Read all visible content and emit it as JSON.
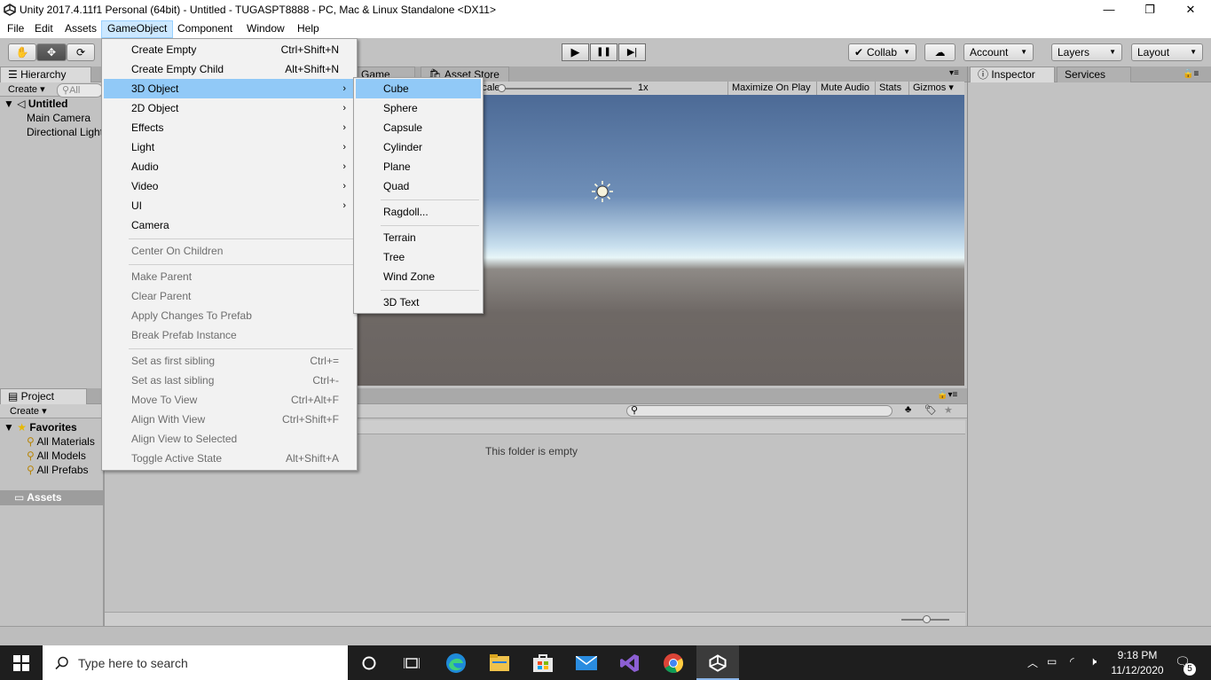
{
  "window": {
    "title": "Unity 2017.4.11f1 Personal (64bit) - Untitled - TUGASPT8888 - PC, Mac & Linux Standalone <DX11>",
    "minimize": "—",
    "restore": "❐",
    "close": "✕"
  },
  "menubar": {
    "items": [
      "File",
      "Edit",
      "Assets",
      "GameObject",
      "Component",
      "Window",
      "Help"
    ],
    "active": "GameObject"
  },
  "toolbar": {
    "tools": [
      "hand-tool",
      "move-tool",
      "rotate-tool"
    ],
    "play": "▶",
    "pause": "❚❚",
    "step": "▶|",
    "collab": "Collab",
    "account": "Account",
    "layers": "Layers",
    "layout": "Layout"
  },
  "hierarchy": {
    "tab": "Hierarchy",
    "create": "Create",
    "search_placeholder": "All",
    "scene": "Untitled",
    "items": [
      "Main Camera",
      "Directional Light"
    ]
  },
  "center_tabs": {
    "game": "Game",
    "asset_store": "Asset Store"
  },
  "scene_bar": {
    "scale_label": "Scale",
    "scale_value": "1x",
    "maximize": "Maximize On Play",
    "mute": "Mute Audio",
    "stats": "Stats",
    "gizmos": "Gizmos"
  },
  "inspector": {
    "tab": "Inspector",
    "services": "Services"
  },
  "project": {
    "tab": "Project",
    "create": "Create",
    "favorites": "Favorites",
    "favorite_items": [
      "All Materials",
      "All Models",
      "All Prefabs"
    ],
    "assets": "Assets",
    "empty_message": "This folder is empty"
  },
  "gameobject_menu": {
    "items": [
      {
        "label": "Create Empty",
        "shortcut": "Ctrl+Shift+N",
        "disabled": false,
        "submenu": false
      },
      {
        "label": "Create Empty Child",
        "shortcut": "Alt+Shift+N",
        "disabled": false,
        "submenu": false
      },
      {
        "label": "3D Object",
        "shortcut": "",
        "disabled": false,
        "submenu": true,
        "selected": true
      },
      {
        "label": "2D Object",
        "shortcut": "",
        "disabled": false,
        "submenu": true
      },
      {
        "label": "Effects",
        "shortcut": "",
        "disabled": false,
        "submenu": true
      },
      {
        "label": "Light",
        "shortcut": "",
        "disabled": false,
        "submenu": true
      },
      {
        "label": "Audio",
        "shortcut": "",
        "disabled": false,
        "submenu": true
      },
      {
        "label": "Video",
        "shortcut": "",
        "disabled": false,
        "submenu": true
      },
      {
        "label": "UI",
        "shortcut": "",
        "disabled": false,
        "submenu": true
      },
      {
        "label": "Camera",
        "shortcut": "",
        "disabled": false,
        "submenu": false
      },
      {
        "label": "Center On Children",
        "shortcut": "",
        "disabled": true,
        "submenu": false
      },
      {
        "label": "Make Parent",
        "shortcut": "",
        "disabled": true,
        "submenu": false
      },
      {
        "label": "Clear Parent",
        "shortcut": "",
        "disabled": true,
        "submenu": false
      },
      {
        "label": "Apply Changes To Prefab",
        "shortcut": "",
        "disabled": true,
        "submenu": false
      },
      {
        "label": "Break Prefab Instance",
        "shortcut": "",
        "disabled": true,
        "submenu": false
      },
      {
        "label": "Set as first sibling",
        "shortcut": "Ctrl+=",
        "disabled": true,
        "submenu": false
      },
      {
        "label": "Set as last sibling",
        "shortcut": "Ctrl+-",
        "disabled": true,
        "submenu": false
      },
      {
        "label": "Move To View",
        "shortcut": "Ctrl+Alt+F",
        "disabled": true,
        "submenu": false
      },
      {
        "label": "Align With View",
        "shortcut": "Ctrl+Shift+F",
        "disabled": true,
        "submenu": false
      },
      {
        "label": "Align View to Selected",
        "shortcut": "",
        "disabled": true,
        "submenu": false
      },
      {
        "label": "Toggle Active State",
        "shortcut": "Alt+Shift+A",
        "disabled": true,
        "submenu": false
      }
    ]
  },
  "object3d_submenu": {
    "items": [
      {
        "label": "Cube",
        "selected": true
      },
      {
        "label": "Sphere"
      },
      {
        "label": "Capsule"
      },
      {
        "label": "Cylinder"
      },
      {
        "label": "Plane"
      },
      {
        "label": "Quad"
      },
      {
        "label": "Ragdoll..."
      },
      {
        "label": "Terrain"
      },
      {
        "label": "Tree"
      },
      {
        "label": "Wind Zone"
      },
      {
        "label": "3D Text"
      }
    ]
  },
  "taskbar": {
    "search_placeholder": "Type here to search",
    "time": "9:18 PM",
    "date": "11/12/2020",
    "notifications": "5"
  }
}
